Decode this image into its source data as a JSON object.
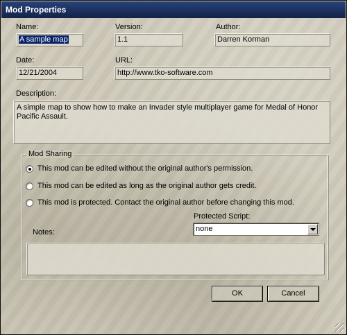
{
  "window": {
    "title": "Mod Properties"
  },
  "fields": {
    "name_label": "Name:",
    "name_value": "A sample map",
    "version_label": "Version:",
    "version_value": "1.1",
    "author_label": "Author:",
    "author_value": "Darren Korman",
    "date_label": "Date:",
    "date_value": "12/21/2004",
    "url_label": "URL:",
    "url_value": "http://www.tko-software.com",
    "description_label": "Description:",
    "description_value": "A simple map to show how to make an Invader style multiplayer game for Medal of Honor Pacific Assault."
  },
  "sharing": {
    "group_label": "Mod Sharing",
    "selected_index": 0,
    "options": [
      "This mod can be edited without the original author's permission.",
      "This mod can be edited as long as the original author gets credit.",
      "This mod is protected. Contact the original author before changing this mod."
    ],
    "protected_script_label": "Protected Script:",
    "protected_script_value": "none",
    "notes_label": "Notes:",
    "notes_value": ""
  },
  "buttons": {
    "ok": "OK",
    "cancel": "Cancel"
  }
}
